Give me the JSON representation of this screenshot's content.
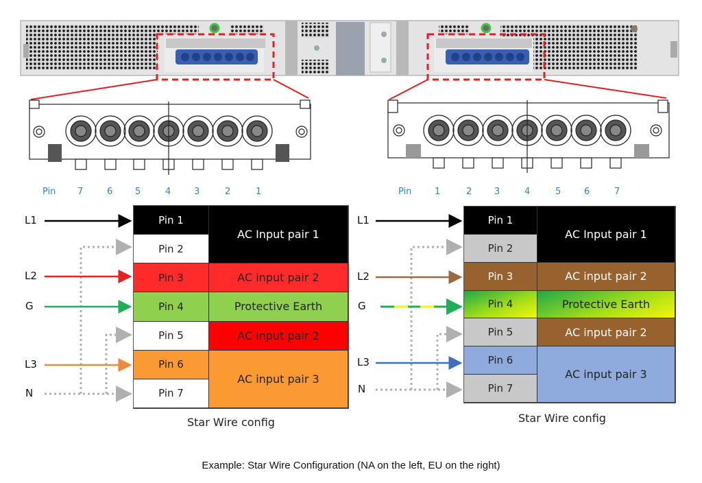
{
  "footer_caption": "Example: Star Wire Configuration (NA on the left, EU on the right)",
  "colors": {
    "highlight_box": "#e02020",
    "connector_blue": "#3a5fb0",
    "pin_label_blue": "#2e86c1",
    "neutral_dotted": "#b0b0b0"
  },
  "panels": [
    {
      "region": "NA",
      "pin_header": {
        "label": "Pin",
        "order": [
          "7",
          "6",
          "5",
          "4",
          "3",
          "2",
          "1"
        ]
      },
      "wires": [
        {
          "label": "L1",
          "to": "Pin 1",
          "color": "#000000",
          "style": "solid"
        },
        {
          "label": "L2",
          "to": "Pin 3",
          "color": "#e52222",
          "style": "solid"
        },
        {
          "label": "G",
          "to": "Pin 4",
          "color": "#1fae55",
          "style": "solid"
        },
        {
          "label": "L3",
          "to": "Pin 6",
          "color": "#ee8a40",
          "style": "solid"
        },
        {
          "label": "N",
          "to": "Pins 2, 5, 7",
          "color": "#b0b0b0",
          "style": "dotted"
        }
      ],
      "pins": [
        {
          "label": "Pin 1",
          "bg": "#000000",
          "fg": "#ffffff"
        },
        {
          "label": "Pin 2",
          "bg": "#ffffff",
          "fg": "#222222"
        },
        {
          "label": "Pin 3",
          "bg": "#ff2a2a",
          "fg": "#222222"
        },
        {
          "label": "Pin 4",
          "bg": "#8fd14f",
          "fg": "#222222"
        },
        {
          "label": "Pin 5",
          "bg": "#ffffff",
          "fg": "#222222"
        },
        {
          "label": "Pin 6",
          "bg": "#fb9a33",
          "fg": "#222222"
        },
        {
          "label": "Pin 7",
          "bg": "#ffffff",
          "fg": "#222222"
        }
      ],
      "groups": [
        {
          "label": "AC Input pair 1",
          "rows": 2,
          "bg": "#000000",
          "fg": "#ffffff"
        },
        {
          "label": "AC input pair 2",
          "rows": 1,
          "bg": "#ff2a2a",
          "fg": "#222222"
        },
        {
          "label": "Protective Earth",
          "rows": 1,
          "bg": "#8fd14f",
          "fg": "#222222"
        },
        {
          "label": "AC input pair 2",
          "rows": 1,
          "bg": "#ff0000",
          "fg": "#222222"
        },
        {
          "label": "AC input pair 3",
          "rows": 2,
          "bg": "#fb9a33",
          "fg": "#222222"
        }
      ],
      "caption": "Star Wire config"
    },
    {
      "region": "EU",
      "pin_header": {
        "label": "Pin",
        "order": [
          "1",
          "2",
          "3",
          "4",
          "5",
          "6",
          "7"
        ]
      },
      "wires": [
        {
          "label": "L1",
          "to": "Pin 1",
          "color": "#000000",
          "style": "solid"
        },
        {
          "label": "L2",
          "to": "Pin 3",
          "color": "#9a6a3f",
          "style": "solid"
        },
        {
          "label": "G",
          "to": "Pin 4",
          "color": "#1fae55",
          "style": "green-yellow"
        },
        {
          "label": "L3",
          "to": "Pin 6",
          "color": "#3d6fc0",
          "style": "solid"
        },
        {
          "label": "N",
          "to": "Pins 2, 5, 7",
          "color": "#b0b0b0",
          "style": "dotted"
        }
      ],
      "pins": [
        {
          "label": "Pin 1",
          "bg": "#000000",
          "fg": "#ffffff"
        },
        {
          "label": "Pin 2",
          "bg": "#c8c8c8",
          "fg": "#222222"
        },
        {
          "label": "Pin 3",
          "bg": "#98622f",
          "fg": "#ffffff"
        },
        {
          "label": "Pin 4",
          "bg": "grad-earth",
          "fg": "#222222"
        },
        {
          "label": "Pin 5",
          "bg": "#c8c8c8",
          "fg": "#222222"
        },
        {
          "label": "Pin 6",
          "bg": "#8faadc",
          "fg": "#222222"
        },
        {
          "label": "Pin 7",
          "bg": "#c8c8c8",
          "fg": "#222222"
        }
      ],
      "groups": [
        {
          "label": "AC Input pair 1",
          "rows": 2,
          "bg": "#000000",
          "fg": "#ffffff"
        },
        {
          "label": "AC input pair 2",
          "rows": 1,
          "bg": "#98622f",
          "fg": "#ffffff"
        },
        {
          "label": "Protective Earth",
          "rows": 1,
          "bg": "grad-earth",
          "fg": "#222222"
        },
        {
          "label": "AC input pair 2",
          "rows": 1,
          "bg": "#98622f",
          "fg": "#ffffff"
        },
        {
          "label": "AC input pair 3",
          "rows": 2,
          "bg": "#8faadc",
          "fg": "#222222"
        }
      ],
      "caption": "Star Wire config"
    }
  ]
}
